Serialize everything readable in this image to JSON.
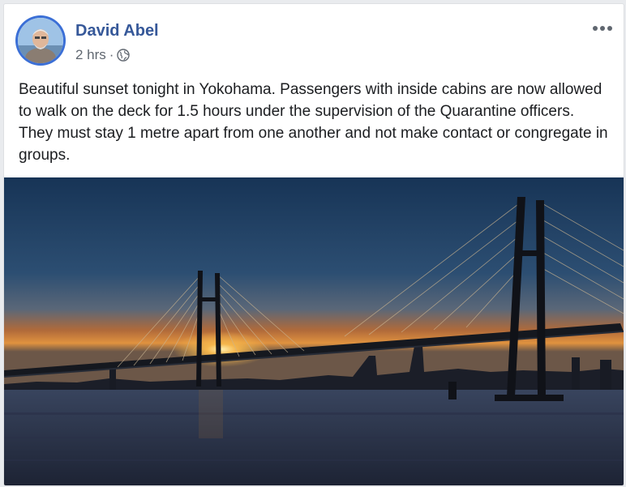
{
  "post": {
    "author": "David Abel",
    "time": "2 hrs",
    "separator": "·",
    "privacy_icon": "globe-icon",
    "more_icon": "more-options-icon",
    "text": "Beautiful sunset tonight in Yokohama. Passengers with inside cabins are now allowed to walk on the deck for 1.5 hours under the supervision of the Quarantine officers. They must stay 1 metre apart from one another and not make contact or congregate in groups.",
    "image_subject": "Yokohama Bay Bridge at sunset"
  },
  "colors": {
    "author_link": "#365899",
    "meta_text": "#606770",
    "body_text": "#1c1e21",
    "avatar_ring": "#3b6fd6"
  }
}
